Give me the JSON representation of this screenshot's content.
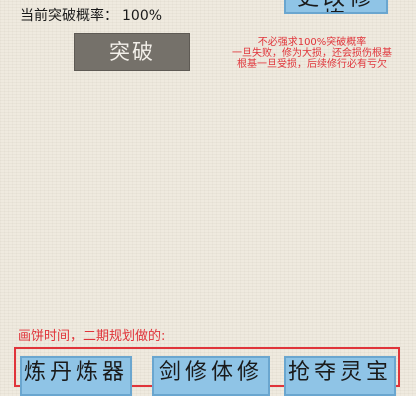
{
  "breakthrough": {
    "rate_label": "当前突破概率：",
    "rate_value": "100%",
    "button_label": "突破"
  },
  "top_button": {
    "label": "更改修炼"
  },
  "warning": {
    "lines": [
      "不必强求100%突破概率",
      "一旦失败，修为大损，还会损伤根基",
      "根基一旦受损，后续修行必有亏欠"
    ],
    "color": "#e0343a"
  },
  "future": {
    "label": "画饼时间，二期规划做的:",
    "items": [
      "炼丹炼器",
      "剑修体修",
      "抢夺灵宝"
    ]
  }
}
